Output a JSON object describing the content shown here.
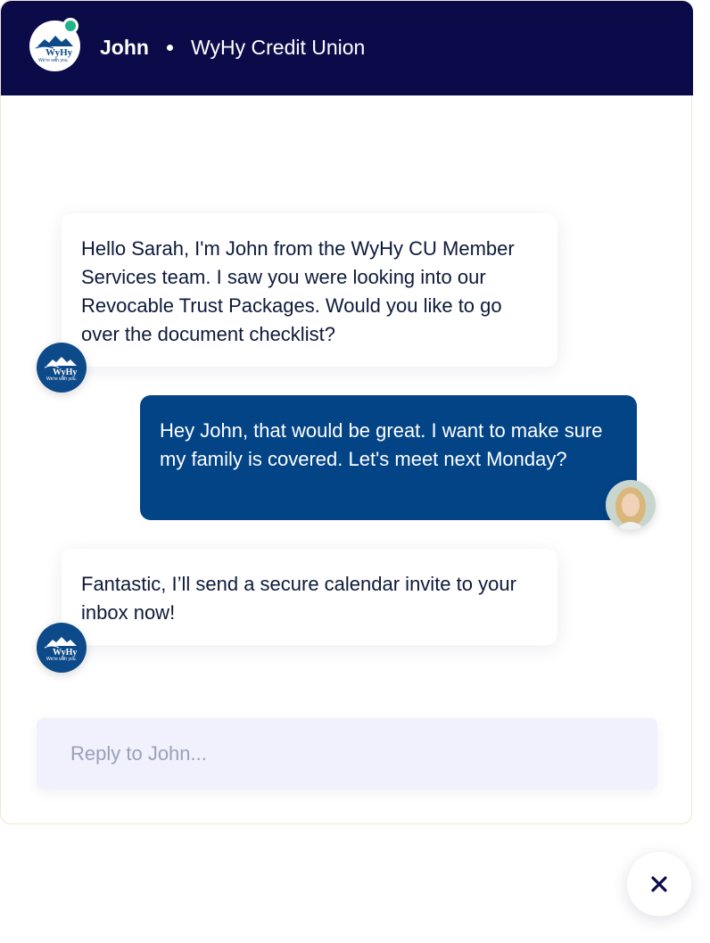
{
  "header": {
    "agent_name": "John",
    "organization": "WyHy Credit Union",
    "status": "online",
    "logo_text": "WyHy",
    "logo_tagline": "We're with you."
  },
  "messages": [
    {
      "sender": "agent",
      "text": "Hello Sarah, I'm John from the WyHy CU Member Services team. I saw you were looking into our Revocable Trust Packages. Would you like to go over the document checklist?"
    },
    {
      "sender": "user",
      "text": "Hey John, that would be great. I want to make sure my family is covered. Let's meet next Monday?"
    },
    {
      "sender": "agent",
      "text": "Fantastic, I’ll send a secure calendar invite to your inbox now!"
    }
  ],
  "reply": {
    "placeholder": "Reply to John...",
    "value": ""
  },
  "icons": {
    "close": "close-icon",
    "online_status": "online-status-icon",
    "logo": "wyhy-logo-icon",
    "user_photo": "user-avatar-photo"
  },
  "colors": {
    "header_bg": "#0b0b4a",
    "user_bubble": "#034486",
    "agent_avatar_bg": "#0d4a8a",
    "online_dot": "#1fb48a",
    "reply_bg": "#f0f1fc"
  }
}
